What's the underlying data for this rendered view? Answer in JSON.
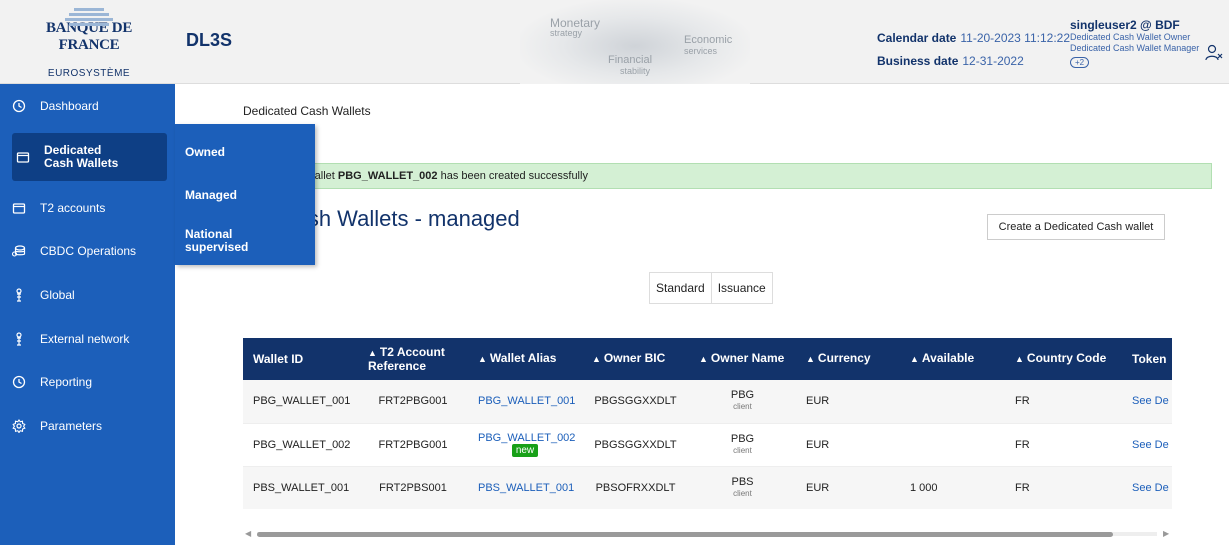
{
  "header": {
    "logo_title": "BANQUE DE FRANCE",
    "logo_subtitle": "EUROSYSTÈME",
    "app_name": "DL3S",
    "hero": {
      "t1": "Monetary",
      "t1b": "strategy",
      "t2": "Economic",
      "t2b": "services",
      "t3": "Financial",
      "t3b": "stability"
    },
    "calendar_label": "Calendar date",
    "calendar_value": "11-20-2023 11:12:22",
    "business_label": "Business date",
    "business_value": "12-31-2022",
    "user_name": "singleuser2 @ BDF",
    "roles": [
      "Dedicated Cash Wallet Owner",
      "Dedicated Cash Wallet Manager"
    ],
    "more_roles": "+2"
  },
  "sidebar": {
    "items": [
      {
        "label": "Dashboard",
        "icon": "clock-icon"
      },
      {
        "label": "Dedicated Cash Wallets",
        "icon": "wallet-icon"
      },
      {
        "label": "T2 accounts",
        "icon": "wallet-icon"
      },
      {
        "label": "CBDC Operations",
        "icon": "coins-icon"
      },
      {
        "label": "Global",
        "icon": "person-icon"
      },
      {
        "label": "External network",
        "icon": "person-icon"
      },
      {
        "label": "Reporting",
        "icon": "clock-icon"
      },
      {
        "label": "Parameters",
        "icon": "gear-icon"
      }
    ],
    "flyout": [
      "Owned",
      "Managed",
      "National supervised"
    ]
  },
  "main": {
    "breadcrumb": "Dedicated Cash Wallets",
    "alert_prefix": "cated Cash wallet ",
    "alert_wallet": "PBG_WALLET_002",
    "alert_suffix": " has been created successfully",
    "title": "ted Cash Wallets - managed",
    "create_button": "Create a Dedicated Cash wallet",
    "toggle": [
      "Standard",
      "Issuance"
    ]
  },
  "table": {
    "columns": [
      "Wallet ID",
      "T2 Account Reference",
      "Wallet Alias",
      "Owner BIC",
      "Owner Name",
      "Currency",
      "Available",
      "Country Code",
      "Token"
    ],
    "rows": [
      {
        "wallet_id": "PBG_WALLET_001",
        "t2_ref": "FRT2PBG001",
        "alias": "PBG_WALLET_001",
        "is_new": false,
        "bic": "PBGSGGXXDLT",
        "owner": "PBG",
        "owner_type": "client",
        "currency": "EUR",
        "available": "",
        "country": "FR",
        "token": "See De"
      },
      {
        "wallet_id": "PBG_WALLET_002",
        "t2_ref": "FRT2PBG001",
        "alias": "PBG_WALLET_002",
        "is_new": true,
        "bic": "PBGSGGXXDLT",
        "owner": "PBG",
        "owner_type": "client",
        "currency": "EUR",
        "available": "",
        "country": "FR",
        "token": "See De"
      },
      {
        "wallet_id": "PBS_WALLET_001",
        "t2_ref": "FRT2PBS001",
        "alias": "PBS_WALLET_001",
        "is_new": false,
        "bic": "PBSOFRXXDLT",
        "owner": "PBS",
        "owner_type": "client",
        "currency": "EUR",
        "available": "1 000",
        "country": "FR",
        "token": "See De"
      }
    ],
    "new_badge": "new"
  },
  "colors": {
    "primary": "#1c5fba",
    "primary_dark": "#12336b",
    "active_nav": "#0e3f85",
    "success_bg": "#d4f0d4",
    "new_badge": "#18a018"
  }
}
